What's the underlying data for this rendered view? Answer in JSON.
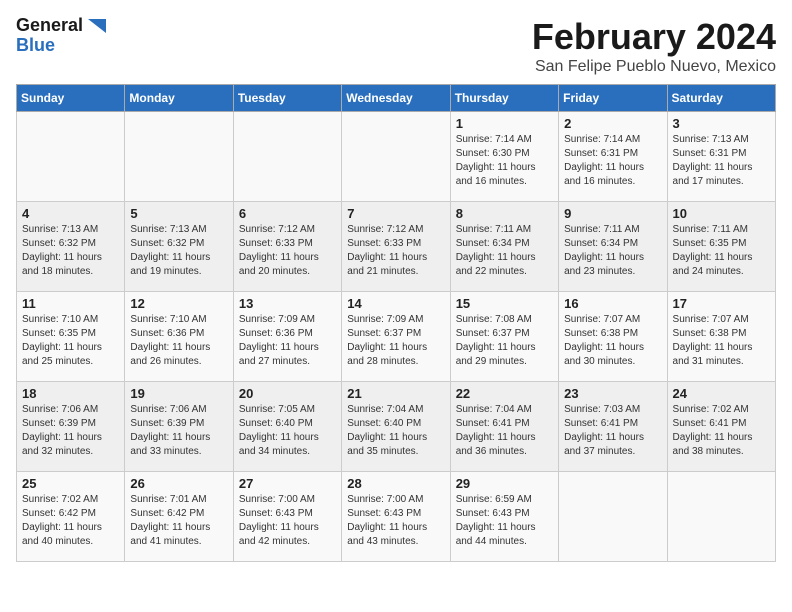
{
  "logo": {
    "line1": "General",
    "line2": "Blue"
  },
  "title": "February 2024",
  "subtitle": "San Felipe Pueblo Nuevo, Mexico",
  "weekdays": [
    "Sunday",
    "Monday",
    "Tuesday",
    "Wednesday",
    "Thursday",
    "Friday",
    "Saturday"
  ],
  "weeks": [
    [
      {
        "day": "",
        "info": ""
      },
      {
        "day": "",
        "info": ""
      },
      {
        "day": "",
        "info": ""
      },
      {
        "day": "",
        "info": ""
      },
      {
        "day": "1",
        "info": "Sunrise: 7:14 AM\nSunset: 6:30 PM\nDaylight: 11 hours\nand 16 minutes."
      },
      {
        "day": "2",
        "info": "Sunrise: 7:14 AM\nSunset: 6:31 PM\nDaylight: 11 hours\nand 16 minutes."
      },
      {
        "day": "3",
        "info": "Sunrise: 7:13 AM\nSunset: 6:31 PM\nDaylight: 11 hours\nand 17 minutes."
      }
    ],
    [
      {
        "day": "4",
        "info": "Sunrise: 7:13 AM\nSunset: 6:32 PM\nDaylight: 11 hours\nand 18 minutes."
      },
      {
        "day": "5",
        "info": "Sunrise: 7:13 AM\nSunset: 6:32 PM\nDaylight: 11 hours\nand 19 minutes."
      },
      {
        "day": "6",
        "info": "Sunrise: 7:12 AM\nSunset: 6:33 PM\nDaylight: 11 hours\nand 20 minutes."
      },
      {
        "day": "7",
        "info": "Sunrise: 7:12 AM\nSunset: 6:33 PM\nDaylight: 11 hours\nand 21 minutes."
      },
      {
        "day": "8",
        "info": "Sunrise: 7:11 AM\nSunset: 6:34 PM\nDaylight: 11 hours\nand 22 minutes."
      },
      {
        "day": "9",
        "info": "Sunrise: 7:11 AM\nSunset: 6:34 PM\nDaylight: 11 hours\nand 23 minutes."
      },
      {
        "day": "10",
        "info": "Sunrise: 7:11 AM\nSunset: 6:35 PM\nDaylight: 11 hours\nand 24 minutes."
      }
    ],
    [
      {
        "day": "11",
        "info": "Sunrise: 7:10 AM\nSunset: 6:35 PM\nDaylight: 11 hours\nand 25 minutes."
      },
      {
        "day": "12",
        "info": "Sunrise: 7:10 AM\nSunset: 6:36 PM\nDaylight: 11 hours\nand 26 minutes."
      },
      {
        "day": "13",
        "info": "Sunrise: 7:09 AM\nSunset: 6:36 PM\nDaylight: 11 hours\nand 27 minutes."
      },
      {
        "day": "14",
        "info": "Sunrise: 7:09 AM\nSunset: 6:37 PM\nDaylight: 11 hours\nand 28 minutes."
      },
      {
        "day": "15",
        "info": "Sunrise: 7:08 AM\nSunset: 6:37 PM\nDaylight: 11 hours\nand 29 minutes."
      },
      {
        "day": "16",
        "info": "Sunrise: 7:07 AM\nSunset: 6:38 PM\nDaylight: 11 hours\nand 30 minutes."
      },
      {
        "day": "17",
        "info": "Sunrise: 7:07 AM\nSunset: 6:38 PM\nDaylight: 11 hours\nand 31 minutes."
      }
    ],
    [
      {
        "day": "18",
        "info": "Sunrise: 7:06 AM\nSunset: 6:39 PM\nDaylight: 11 hours\nand 32 minutes."
      },
      {
        "day": "19",
        "info": "Sunrise: 7:06 AM\nSunset: 6:39 PM\nDaylight: 11 hours\nand 33 minutes."
      },
      {
        "day": "20",
        "info": "Sunrise: 7:05 AM\nSunset: 6:40 PM\nDaylight: 11 hours\nand 34 minutes."
      },
      {
        "day": "21",
        "info": "Sunrise: 7:04 AM\nSunset: 6:40 PM\nDaylight: 11 hours\nand 35 minutes."
      },
      {
        "day": "22",
        "info": "Sunrise: 7:04 AM\nSunset: 6:41 PM\nDaylight: 11 hours\nand 36 minutes."
      },
      {
        "day": "23",
        "info": "Sunrise: 7:03 AM\nSunset: 6:41 PM\nDaylight: 11 hours\nand 37 minutes."
      },
      {
        "day": "24",
        "info": "Sunrise: 7:02 AM\nSunset: 6:41 PM\nDaylight: 11 hours\nand 38 minutes."
      }
    ],
    [
      {
        "day": "25",
        "info": "Sunrise: 7:02 AM\nSunset: 6:42 PM\nDaylight: 11 hours\nand 40 minutes."
      },
      {
        "day": "26",
        "info": "Sunrise: 7:01 AM\nSunset: 6:42 PM\nDaylight: 11 hours\nand 41 minutes."
      },
      {
        "day": "27",
        "info": "Sunrise: 7:00 AM\nSunset: 6:43 PM\nDaylight: 11 hours\nand 42 minutes."
      },
      {
        "day": "28",
        "info": "Sunrise: 7:00 AM\nSunset: 6:43 PM\nDaylight: 11 hours\nand 43 minutes."
      },
      {
        "day": "29",
        "info": "Sunrise: 6:59 AM\nSunset: 6:43 PM\nDaylight: 11 hours\nand 44 minutes."
      },
      {
        "day": "",
        "info": ""
      },
      {
        "day": "",
        "info": ""
      }
    ]
  ]
}
